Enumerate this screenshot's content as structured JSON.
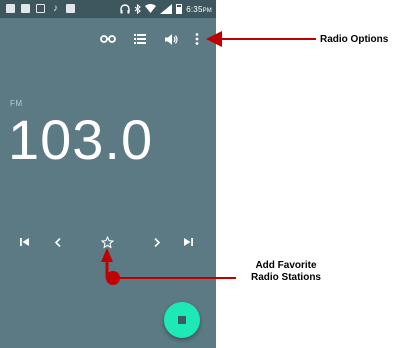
{
  "status_bar": {
    "time": "6:35",
    "time_suffix": "PM",
    "left_icons": [
      "notification-icon",
      "gallery-icon",
      "briefcase-icon",
      "music-icon",
      "image-icon"
    ],
    "right_icons": [
      "headset-icon",
      "bluetooth-icon",
      "wifi-icon",
      "signal-icon",
      "battery-icon"
    ]
  },
  "toolbar": {
    "icons": [
      "headphones-icon",
      "station-list-icon",
      "speaker-icon",
      "more-vert-icon"
    ]
  },
  "radio": {
    "band": "FM",
    "frequency": "103.0"
  },
  "controls": {
    "icons": [
      "skip-previous-icon",
      "seek-back-icon",
      "favorite-star-icon",
      "seek-forward-icon",
      "skip-next-icon"
    ]
  },
  "fab": {
    "icon": "stop-icon",
    "color": "#1de9b6"
  },
  "colors": {
    "screen_bg": "#5b7a84",
    "status_bar_bg": "#3e575f",
    "annotation": "#c00000"
  },
  "annotations": {
    "radio_options": "Radio Options",
    "add_favorite_line1": "Add Favorite",
    "add_favorite_line2": "Radio Stations"
  }
}
